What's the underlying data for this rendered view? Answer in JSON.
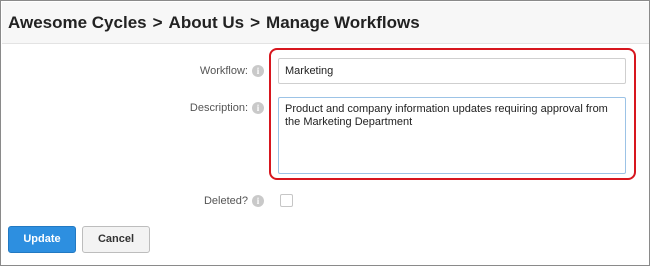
{
  "breadcrumb": {
    "site": "Awesome Cycles",
    "separator": ">",
    "section": "About Us",
    "page": "Manage Workflows"
  },
  "form": {
    "workflow": {
      "label": "Workflow:",
      "info": "i",
      "value": "Marketing"
    },
    "description": {
      "label": "Description:",
      "info": "i",
      "value": "Product and company information updates requiring approval from the Marketing Department"
    },
    "deleted": {
      "label": "Deleted?",
      "info": "i",
      "checked": false
    }
  },
  "actions": {
    "update_label": "Update",
    "cancel_label": "Cancel"
  },
  "colors": {
    "primary": "#2d8fe0",
    "highlight": "#d7161e"
  }
}
